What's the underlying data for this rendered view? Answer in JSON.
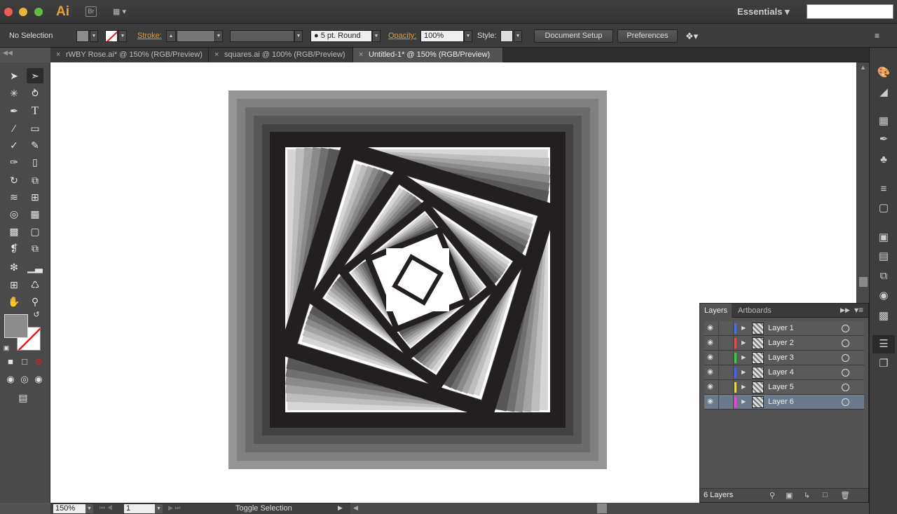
{
  "app": {
    "logo": "Ai",
    "bridge": "Br",
    "workspace": "Essentials"
  },
  "control": {
    "selection": "No Selection",
    "stroke_label": "Stroke:",
    "brush_value": "5 pt. Round",
    "opacity_label": "Opacity:",
    "opacity_value": "100%",
    "style_label": "Style:",
    "document_setup": "Document Setup",
    "preferences": "Preferences"
  },
  "tabs": [
    {
      "label": "rWBY Rose.ai* @ 150% (RGB/Preview)"
    },
    {
      "label": "squares.ai @ 100% (RGB/Preview)"
    },
    {
      "label": "Untitled-1* @ 150% (RGB/Preview)"
    }
  ],
  "status": {
    "zoom": "150%",
    "artboard": "1",
    "mode": "Toggle Selection"
  },
  "layers_panel": {
    "tab_layers": "Layers",
    "tab_artboards": "Artboards",
    "footer": "6 Layers",
    "layers": [
      {
        "name": "Layer 1",
        "color": "#4a6fe3"
      },
      {
        "name": "Layer 2",
        "color": "#e34a4a"
      },
      {
        "name": "Layer 3",
        "color": "#3cc94a"
      },
      {
        "name": "Layer 4",
        "color": "#4a5fe3"
      },
      {
        "name": "Layer 5",
        "color": "#e3d94a"
      },
      {
        "name": "Layer 6",
        "color": "#e34ad4"
      }
    ]
  },
  "colors": {
    "accent_orange": "#e89a3a",
    "artwork_dark": "#231f20"
  }
}
